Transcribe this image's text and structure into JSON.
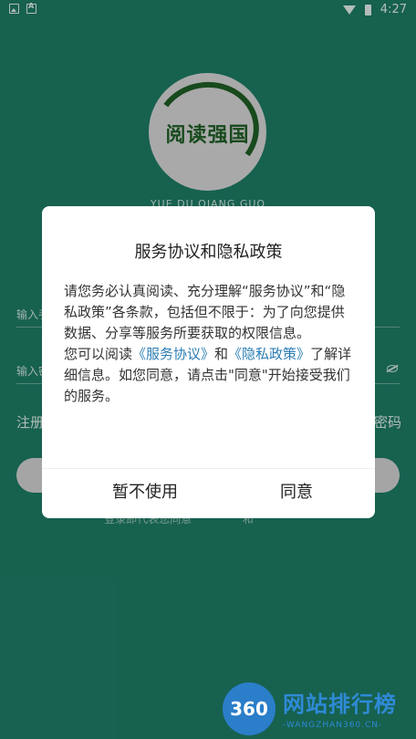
{
  "status_bar": {
    "time": "4:27"
  },
  "app": {
    "logo_text": "阅读强国",
    "logo_subtitle": "YUE DU QIANG GUO",
    "account_placeholder": "输入手",
    "password_placeholder": "输入密",
    "register_label": "注册",
    "forgot_label": "密码",
    "agree_prefix": "登录即代表您同意",
    "agree_and": "和"
  },
  "dialog": {
    "title": "服务协议和隐私政策",
    "body_p1": "请您务必认真阅读、充分理解“服务协议”和“隐私政策”各条款，包括但不限于：为了向您提供数据、分享等服务所要获取的权限信息。",
    "body_p2_prefix": "您可以阅读",
    "link_service": "《服务协议》",
    "body_p2_and": "和",
    "link_privacy": "《隐私政策》",
    "body_p2_suffix": "了解详细信息。如您同意，请点击\"同意\"开始接受我们的服务。",
    "cancel_label": "暂不使用",
    "agree_label": "同意"
  },
  "watermark": {
    "badge": "360",
    "title": "网站排行榜",
    "subtitle": "-WANGZHAN360.CN-"
  },
  "colors": {
    "background": "#1e7d66",
    "link": "#2c7db4",
    "logo_green": "#1f5f26"
  }
}
